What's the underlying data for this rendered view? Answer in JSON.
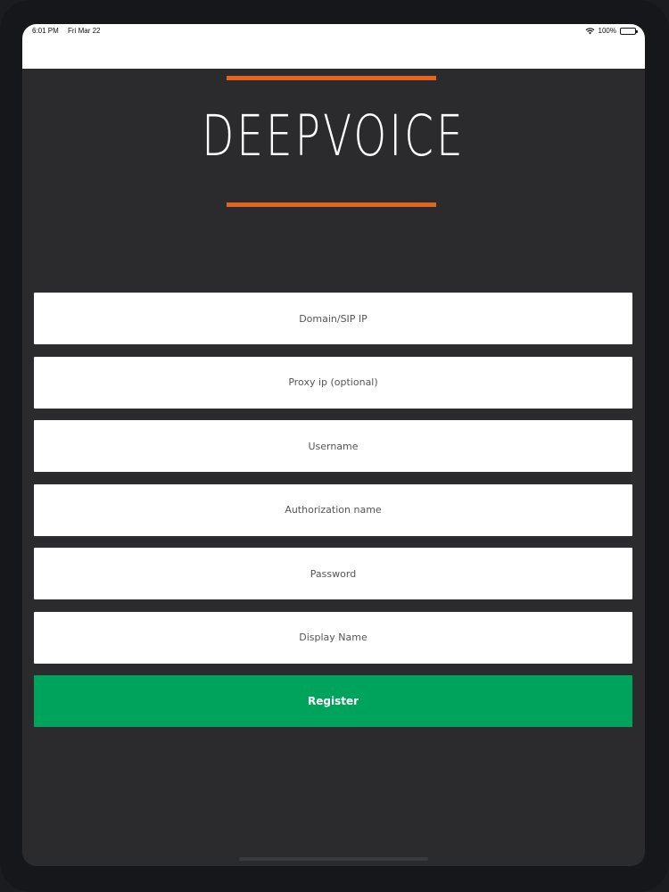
{
  "status_bar": {
    "time": "6:01 PM",
    "date": "Fri Mar 22",
    "battery": "100%",
    "icons": [
      "wifi-icon",
      "battery-icon"
    ]
  },
  "logo": {
    "text": "DEEPVOICE",
    "accent_color": "#e0661f"
  },
  "form": {
    "domain_placeholder": "Domain/SIP IP",
    "proxy_placeholder": "Proxy ip (optional)",
    "username_placeholder": "Username",
    "auth_name_placeholder": "Authorization name",
    "password_placeholder": "Password",
    "display_name_placeholder": "Display Name",
    "register_label": "Register",
    "register_color": "#00a35c"
  },
  "colors": {
    "background": "#2b2b2d",
    "status_bar": "#ffffff"
  }
}
